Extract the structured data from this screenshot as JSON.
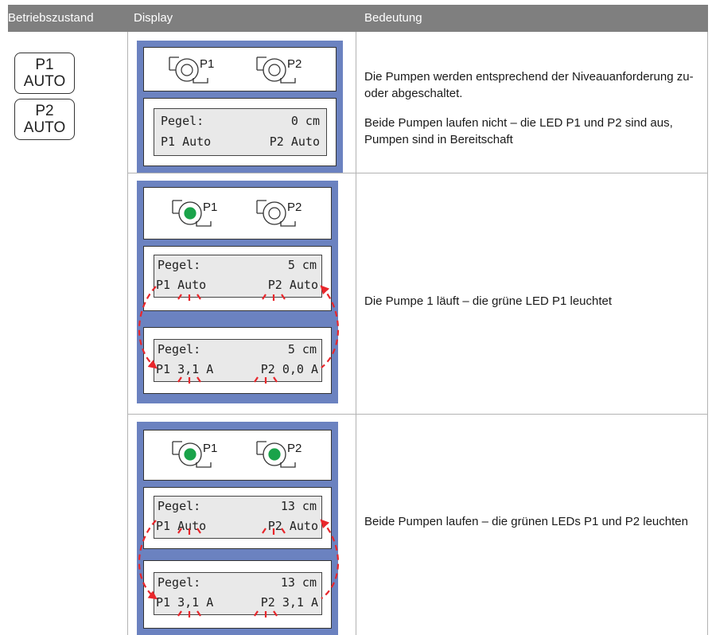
{
  "header": {
    "col_state": "Betriebszustand",
    "col_display": "Display",
    "col_meaning": "Bedeutung"
  },
  "states": [
    {
      "line1": "P1",
      "line2": "AUTO"
    },
    {
      "line1": "P2",
      "line2": "AUTO"
    }
  ],
  "pump_labels": {
    "p1": "P1",
    "p2": "P2"
  },
  "rows": [
    {
      "led_p1": "off",
      "led_p2": "off",
      "screens": [
        {
          "level_label": "Pegel:",
          "level_value": "0 cm",
          "left": "P1 Auto",
          "right": "P2 Auto"
        }
      ],
      "description": [
        "Die Pumpen werden entsprechend der Niveauanforderung zu- oder abgeschaltet.",
        "Beide Pumpen laufen nicht – die LED P1 und P2 sind aus, Pumpen sind in Bereitschaft"
      ]
    },
    {
      "led_p1": "green",
      "led_p2": "off",
      "screens": [
        {
          "level_label": "Pegel:",
          "level_value": "5 cm",
          "left": "P1 Auto",
          "right": "P2 Auto"
        },
        {
          "level_label": "Pegel:",
          "level_value": "5 cm",
          "left": "P1 3,1 A",
          "right": "P2 0,0 A"
        }
      ],
      "description": [
        "Die Pumpe 1 läuft – die grüne LED P1 leuchtet"
      ]
    },
    {
      "led_p1": "green",
      "led_p2": "green",
      "screens": [
        {
          "level_label": "Pegel:",
          "level_value": "13 cm",
          "left": "P1 Auto",
          "right": "P2 Auto"
        },
        {
          "level_label": "Pegel:",
          "level_value": "13 cm",
          "left": "P1 3,1 A",
          "right": "P2 3,1 A"
        }
      ],
      "description": [
        "Beide Pumpen laufen – die grünen LEDs P1 und P2 leuchten"
      ]
    }
  ],
  "colors": {
    "header_bg": "#7f7f7f",
    "panel_bg": "#6b82c0",
    "led_green": "#1aa34a",
    "lcd_bg": "#e9e9e9",
    "blink_arrow": "#e8262b"
  }
}
